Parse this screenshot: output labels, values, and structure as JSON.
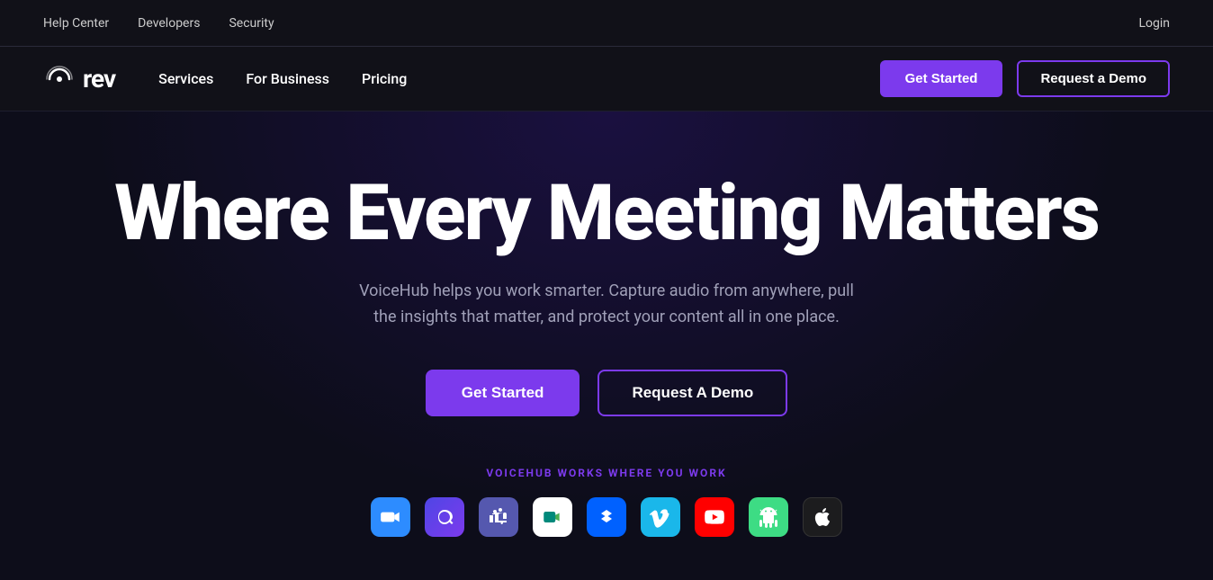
{
  "topbar": {
    "links": [
      "Help Center",
      "Developers",
      "Security"
    ],
    "login_label": "Login"
  },
  "nav": {
    "logo_text": "rev",
    "links": [
      "Services",
      "For Business",
      "Pricing"
    ],
    "btn_get_started": "Get Started",
    "btn_request_demo": "Request a Demo"
  },
  "hero": {
    "title": "Where Every Meeting Matters",
    "subtitle": "VoiceHub helps you work smarter. Capture audio from anywhere, pull the insights that matter, and protect your content all in one place.",
    "btn_primary": "Get Started",
    "btn_secondary": "Request A Demo",
    "works_label": "VOICEHUB WORKS WHERE YOU WORK",
    "app_icons": [
      {
        "name": "zoom",
        "symbol": "📹",
        "bg": "#2d8cff"
      },
      {
        "name": "vowel",
        "symbol": "🎧",
        "bg": "#7c3aed"
      },
      {
        "name": "teams",
        "symbol": "T",
        "bg": "#5558af"
      },
      {
        "name": "meet",
        "symbol": "M",
        "bg": "#00897b"
      },
      {
        "name": "dropbox",
        "symbol": "📦",
        "bg": "#0061ff"
      },
      {
        "name": "vimeo",
        "symbol": "▶",
        "bg": "#1ab7ea"
      },
      {
        "name": "youtube",
        "symbol": "▶",
        "bg": "#ff0000"
      },
      {
        "name": "android",
        "symbol": "🤖",
        "bg": "#3ddc84"
      },
      {
        "name": "apple",
        "symbol": "",
        "bg": "#1c1c1e"
      }
    ]
  }
}
